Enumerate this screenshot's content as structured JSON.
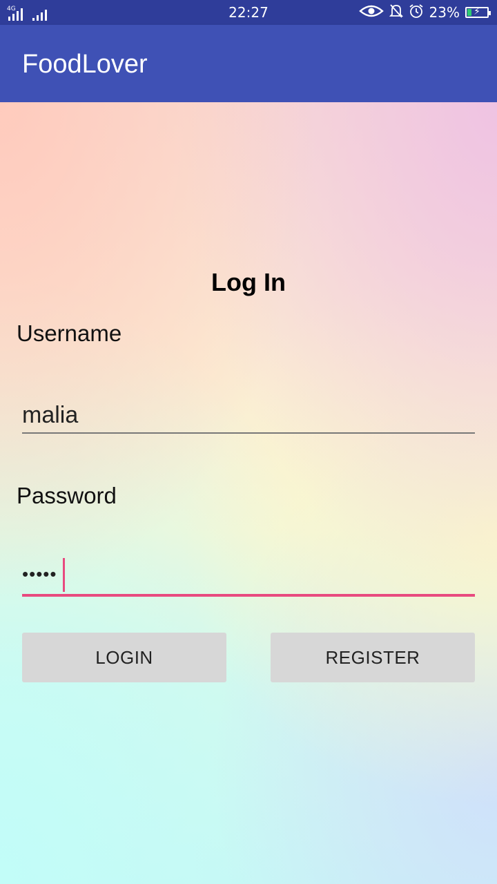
{
  "status_bar": {
    "network_type": "4G",
    "time": "22:27",
    "eye_icon": "eye-icon",
    "notifications_icon": "bell-off-icon",
    "alarm_icon": "alarm-clock-icon",
    "battery_percent": "23%",
    "battery_level": 0.23,
    "battery_color": "#2ecc71"
  },
  "app_bar": {
    "title": "FoodLover",
    "color": "#3f51b5"
  },
  "form": {
    "title": "Log In",
    "username_label": "Username",
    "username_value": "malia",
    "password_label": "Password",
    "password_masked": "•••••",
    "accent_color": "#e84a7f",
    "login_button": "LOGIN",
    "register_button": "REGISTER"
  }
}
